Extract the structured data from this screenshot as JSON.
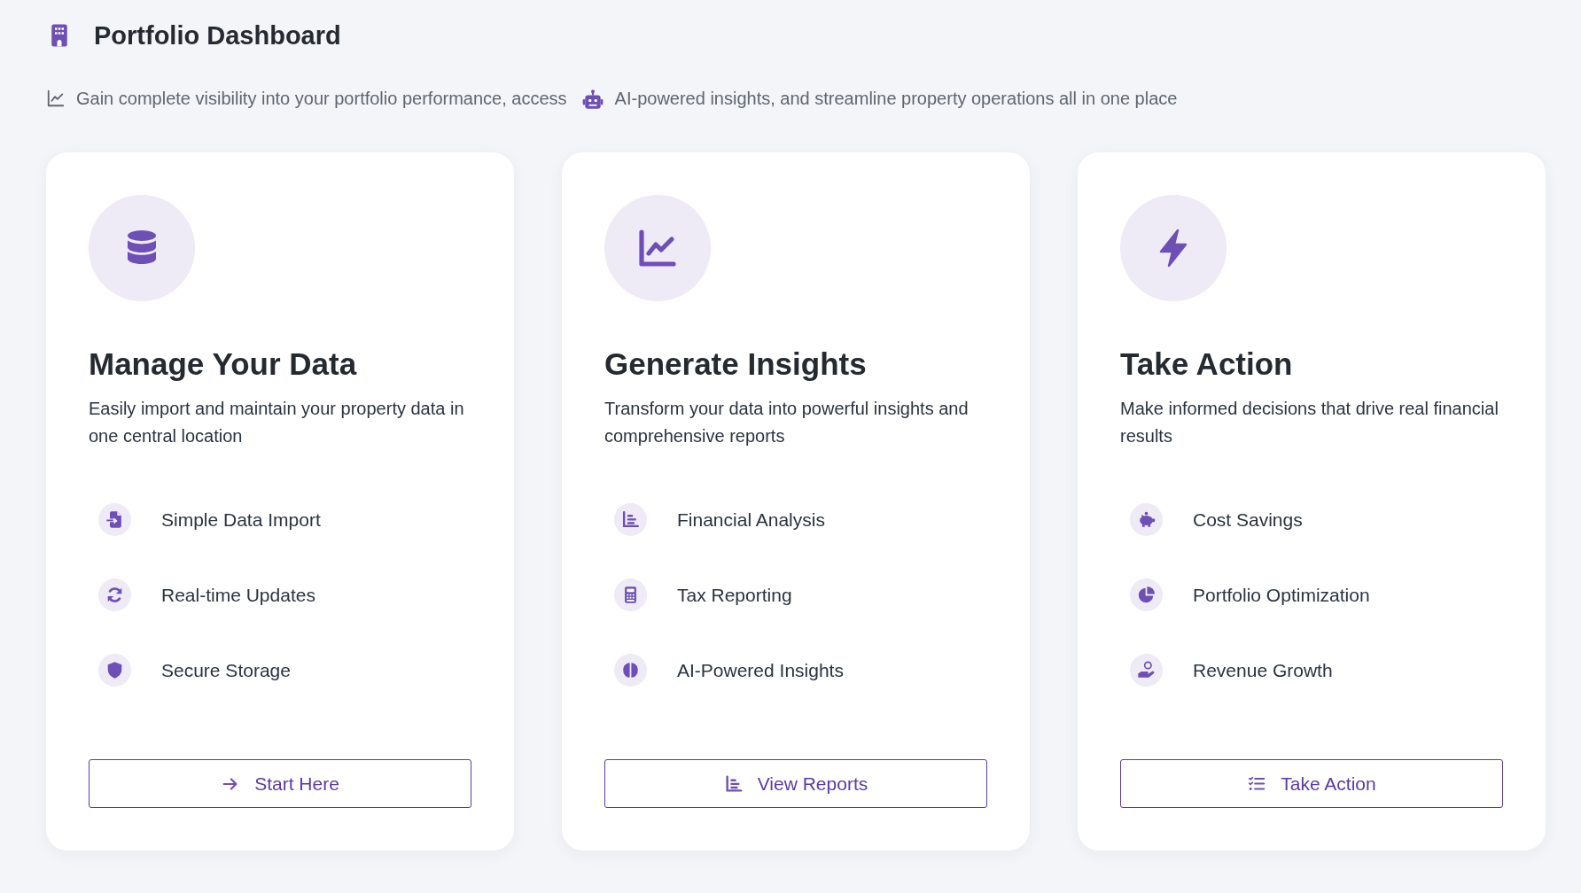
{
  "header": {
    "title": "Portfolio Dashboard",
    "subtitle_parts": [
      "Gain complete visibility into your portfolio performance, access",
      "AI-powered insights, and streamline property operations all in one place"
    ]
  },
  "cards": [
    {
      "title": "Manage Your Data",
      "description": "Easily import and maintain your property data in one central location",
      "features": [
        "Simple Data Import",
        "Real-time Updates",
        "Secure Storage"
      ],
      "button": "Start Here"
    },
    {
      "title": "Generate Insights",
      "description": "Transform your data into powerful insights and comprehensive reports",
      "features": [
        "Financial Analysis",
        "Tax Reporting",
        "AI-Powered Insights"
      ],
      "button": "View Reports"
    },
    {
      "title": "Take Action",
      "description": "Make informed decisions that drive real financial results",
      "features": [
        "Cost Savings",
        "Portfolio Optimization",
        "Revenue Growth"
      ],
      "button": "Take Action"
    }
  ]
}
